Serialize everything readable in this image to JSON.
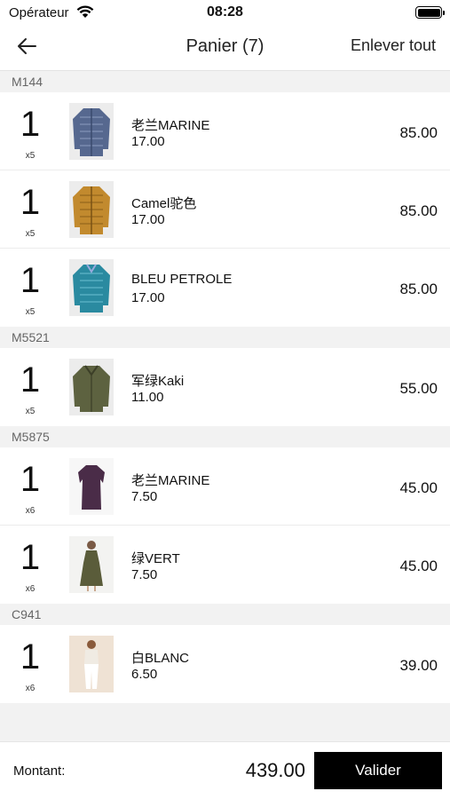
{
  "status_bar": {
    "carrier": "Opérateur",
    "time": "08:28"
  },
  "nav": {
    "back_icon": "back-arrow-icon",
    "title": "Panier (7)",
    "remove_all_label": "Enlever tout"
  },
  "sections": [
    {
      "code": "M144",
      "items": [
        {
          "qty": "1",
          "multiplier": "x5",
          "name": "老兰MARINE",
          "unit_price": "17.00",
          "total": "85.00",
          "image": "navy-puffer-jacket",
          "color": "#56688f"
        },
        {
          "qty": "1",
          "multiplier": "x5",
          "name": "Camel驼色",
          "unit_price": "17.00",
          "total": "85.00",
          "image": "camel-puffer-jacket",
          "color": "#c28a2e"
        },
        {
          "qty": "1",
          "multiplier": "x5",
          "name": "BLEU PETROLE",
          "unit_price": "17.00",
          "total": "85.00",
          "image": "petrol-blue-puffer-jacket",
          "color": "#2a8aa0"
        }
      ]
    },
    {
      "code": "M5521",
      "items": [
        {
          "qty": "1",
          "multiplier": "x5",
          "name": "军绿Kaki",
          "unit_price": "11.00",
          "total": "55.00",
          "image": "khaki-jacket",
          "color": "#5d6240"
        }
      ]
    },
    {
      "code": "M5875",
      "items": [
        {
          "qty": "1",
          "multiplier": "x6",
          "name": "老兰MARINE",
          "unit_price": "7.50",
          "total": "45.00",
          "image": "plum-dress",
          "color": "#4a2c48"
        },
        {
          "qty": "1",
          "multiplier": "x6",
          "name": "绿VERT",
          "unit_price": "7.50",
          "total": "45.00",
          "image": "green-dress",
          "color": "#5a5c3a"
        }
      ]
    },
    {
      "code": "C941",
      "items": [
        {
          "qty": "1",
          "multiplier": "x6",
          "name": "白BLANC",
          "unit_price": "6.50",
          "total": "39.00",
          "image": "white-outfit",
          "color": "#f0ebe3"
        }
      ]
    }
  ],
  "footer": {
    "amount_label": "Montant:",
    "amount": "439.00",
    "validate_label": "Valider"
  }
}
